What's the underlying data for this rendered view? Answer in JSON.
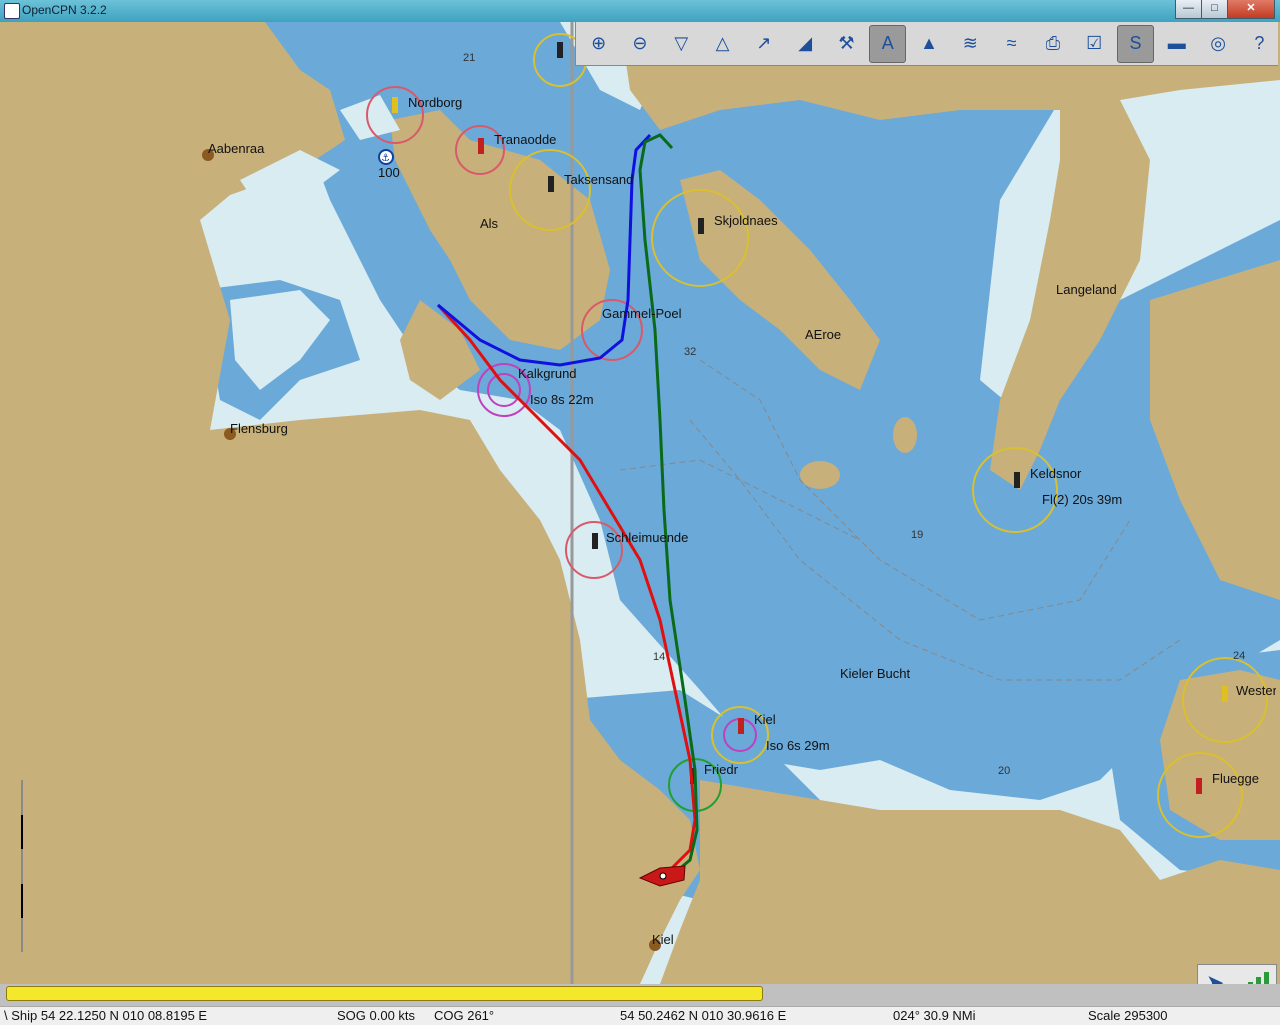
{
  "window": {
    "title": "OpenCPN 3.2.2",
    "min_label": "—",
    "max_label": "□",
    "close_label": "✕"
  },
  "toolbar": {
    "tools": [
      {
        "icon": "zoom-in-icon",
        "glyph": "⊕",
        "active": false
      },
      {
        "icon": "zoom-out-icon",
        "glyph": "⊖",
        "active": false
      },
      {
        "icon": "scale-in-icon",
        "glyph": "▽",
        "active": false
      },
      {
        "icon": "scale-out-icon",
        "glyph": "△",
        "active": false
      },
      {
        "icon": "route-icon",
        "glyph": "↗",
        "active": false
      },
      {
        "icon": "auto-follow-icon",
        "glyph": "◢",
        "active": false
      },
      {
        "icon": "settings-icon",
        "glyph": "⚒",
        "active": false
      },
      {
        "icon": "text-icon",
        "glyph": "A",
        "active": true
      },
      {
        "icon": "current-icon",
        "glyph": "▲",
        "active": false
      },
      {
        "icon": "tide-icon",
        "glyph": "≋",
        "active": false
      },
      {
        "icon": "chart-icon",
        "glyph": "≈",
        "active": false
      },
      {
        "icon": "print-icon",
        "glyph": "⎙",
        "active": false
      },
      {
        "icon": "route-manager-icon",
        "glyph": "☑",
        "active": false
      },
      {
        "icon": "track-icon",
        "glyph": "S",
        "active": true
      },
      {
        "icon": "color-scheme-icon",
        "glyph": "▬",
        "active": false
      },
      {
        "icon": "mob-icon",
        "glyph": "◎",
        "active": false
      },
      {
        "icon": "help-icon",
        "glyph": "?",
        "active": false
      }
    ]
  },
  "map": {
    "places": [
      {
        "name": "Aabenraa"
      },
      {
        "name": "Nordborg"
      },
      {
        "name": "Tranaodde"
      },
      {
        "name": "Taksensand"
      },
      {
        "name": "Als"
      },
      {
        "name": "Skjoldnaes"
      },
      {
        "name": "Langeland"
      },
      {
        "name": "Gammel-Poel"
      },
      {
        "name": "AEroe"
      },
      {
        "name": "Kalkgrund"
      },
      {
        "name": "Iso 8s 22m"
      },
      {
        "name": "Flensburg"
      },
      {
        "name": "Keldsnor"
      },
      {
        "name": "Fl(2) 20s 39m"
      },
      {
        "name": "Schleimuende"
      },
      {
        "name": "Kieler Bucht"
      },
      {
        "name": "Kiel"
      },
      {
        "name": "Iso 6s 29m"
      },
      {
        "name": "Friedrichsort"
      },
      {
        "name": "Westermarkelsdorf"
      },
      {
        "name": "Fluegge"
      },
      {
        "name": "Kiel"
      }
    ],
    "anchorage_label": "100",
    "depths": [
      {
        "value": "21"
      },
      {
        "value": "32"
      },
      {
        "value": "19"
      },
      {
        "value": "14"
      },
      {
        "value": "20"
      },
      {
        "value": "24"
      }
    ],
    "colors": {
      "land": "#c8b07a",
      "shallow_water": "#6aa9d8",
      "deep_water": "#d8ecf2",
      "track_red": "#e01010",
      "track_blue": "#1010e0",
      "track_green": "#0a6a1a",
      "ship": "#c81818"
    }
  },
  "status": {
    "ship_position": "\\ Ship 54 22.1250 N   010 08.8195 E",
    "sog": "SOG 0.00 kts",
    "cog": "COG 261°",
    "cursor_position": "54 50.2462 N   010 30.9616 E",
    "bearing_distance": "024°   30.9 NMi",
    "scale": "Scale 295300",
    "progress_fraction": 0.59
  }
}
